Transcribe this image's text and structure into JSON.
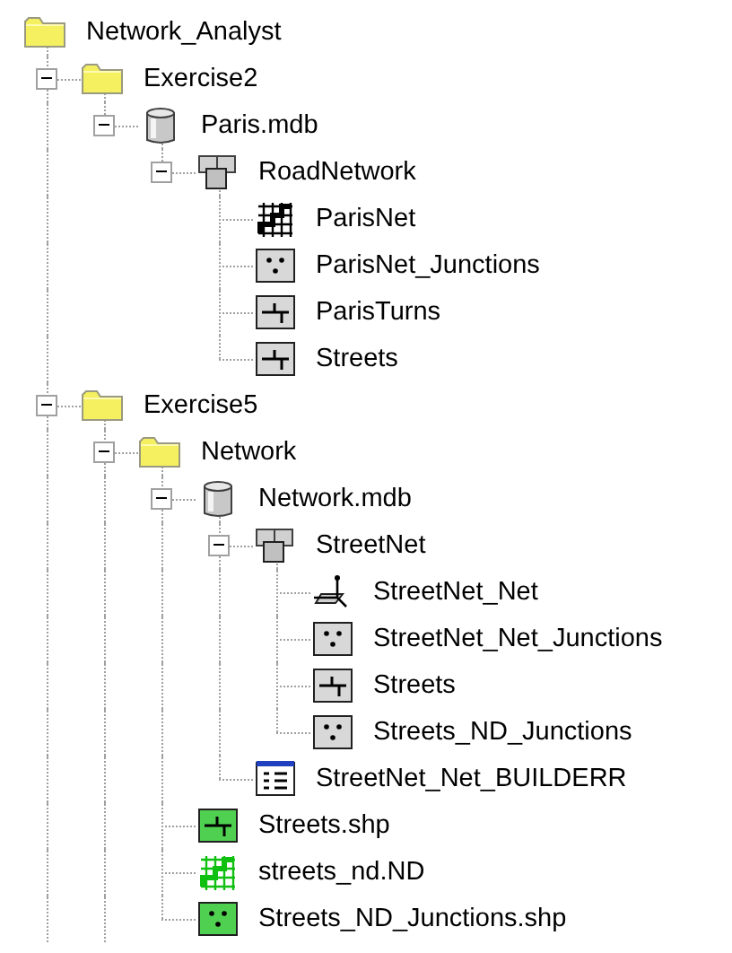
{
  "tree": {
    "name": "Network_Analyst",
    "kind": "folder",
    "children": [
      {
        "name": "Exercise2",
        "kind": "folder",
        "expanded": true,
        "children": [
          {
            "name": "Paris.mdb",
            "kind": "database",
            "expanded": true,
            "children": [
              {
                "name": "RoadNetwork",
                "kind": "dataset",
                "expanded": true,
                "children": [
                  {
                    "name": "ParisNet",
                    "kind": "network"
                  },
                  {
                    "name": "ParisNet_Junctions",
                    "kind": "point"
                  },
                  {
                    "name": "ParisTurns",
                    "kind": "line"
                  },
                  {
                    "name": "Streets",
                    "kind": "line"
                  }
                ]
              }
            ]
          }
        ]
      },
      {
        "name": "Exercise5",
        "kind": "folder",
        "expanded": true,
        "children": [
          {
            "name": "Network",
            "kind": "folder",
            "expanded": true,
            "children": [
              {
                "name": "Network.mdb",
                "kind": "database",
                "expanded": true,
                "children": [
                  {
                    "name": "StreetNet",
                    "kind": "dataset",
                    "expanded": true,
                    "children": [
                      {
                        "name": "StreetNet_Net",
                        "kind": "geometric"
                      },
                      {
                        "name": "StreetNet_Net_Junctions",
                        "kind": "point"
                      },
                      {
                        "name": "Streets",
                        "kind": "line"
                      },
                      {
                        "name": "Streets_ND_Junctions",
                        "kind": "point"
                      }
                    ]
                  },
                  {
                    "name": "StreetNet_Net_BUILDERR",
                    "kind": "table"
                  }
                ]
              },
              {
                "name": "Streets.shp",
                "kind": "line_shp"
              },
              {
                "name": "streets_nd.ND",
                "kind": "network_shp"
              },
              {
                "name": "Streets_ND_Junctions.shp",
                "kind": "point_shp"
              }
            ]
          }
        ]
      }
    ]
  }
}
